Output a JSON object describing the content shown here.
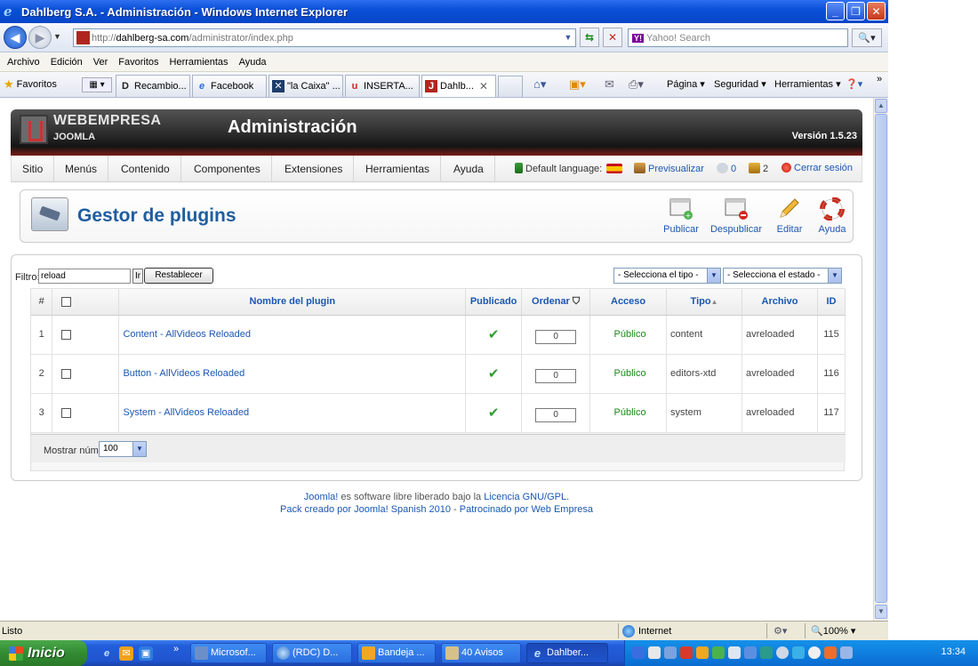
{
  "window": {
    "title": "Dahlberg S.A. - Administración - Windows Internet Explorer",
    "minimize": "_",
    "maximize": "❐",
    "close": "✕"
  },
  "address": {
    "url_prefix": "http://",
    "url_domain": "dahlberg-sa.com",
    "url_path": "/administrator/index.php",
    "search_placeholder": "Yahoo! Search",
    "search_logo": "Y!"
  },
  "menubar": [
    "Archivo",
    "Edición",
    "Ver",
    "Favoritos",
    "Herramientas",
    "Ayuda"
  ],
  "favorites_label": "Favoritos",
  "browser_tabs": [
    {
      "label": "Recambio...",
      "icon": "D"
    },
    {
      "label": "Facebook",
      "icon": "e"
    },
    {
      "label": "\"la Caixa\" ...",
      "icon": "✕"
    },
    {
      "label": "INSERTA...",
      "icon": "u"
    },
    {
      "label": "Dahlb...",
      "icon": "J",
      "active": true
    }
  ],
  "commands": {
    "page": "Página ▾",
    "security": "Seguridad ▾",
    "tools": "Herramientas ▾",
    "help": "❓▾",
    "more": "»"
  },
  "joomla": {
    "brand": "WEBEMPRESA",
    "brand_sub": "JOOMLA",
    "title": "Administración",
    "version": "Versión 1.5.23",
    "menu": [
      "Sitio",
      "Menús",
      "Contenido",
      "Componentes",
      "Extensiones",
      "Herramientas",
      "Ayuda"
    ],
    "status": {
      "language": "Default language:",
      "preview": "Previsualizar",
      "messages": "0",
      "users": "2",
      "logout": "Cerrar sesión"
    }
  },
  "toolbar": {
    "page_title": "Gestor de plugins",
    "publish": "Publicar",
    "unpublish": "Despublicar",
    "edit": "Editar",
    "help": "Ayuda"
  },
  "filter": {
    "label": "Filtro:",
    "value": "reload",
    "go": "Ir",
    "reset": "Restablecer",
    "type_select": "- Selecciona el tipo -",
    "state_select": "- Selecciona el estado -"
  },
  "table": {
    "headers": {
      "num": "#",
      "name": "Nombre del plugin",
      "published": "Publicado",
      "order": "Ordenar",
      "access": "Acceso",
      "type": "Tipo",
      "file": "Archivo",
      "id": "ID"
    },
    "rows": [
      {
        "num": "1",
        "name": "Content - AllVideos Reloaded",
        "order": "0",
        "access": "Público",
        "type": "content",
        "file": "avreloaded",
        "id": "115"
      },
      {
        "num": "2",
        "name": "Button - AllVideos Reloaded",
        "order": "0",
        "access": "Público",
        "type": "editors-xtd",
        "file": "avreloaded",
        "id": "116"
      },
      {
        "num": "3",
        "name": "System - AllVideos Reloaded",
        "order": "0",
        "access": "Público",
        "type": "system",
        "file": "avreloaded",
        "id": "117"
      }
    ],
    "show_label": "Mostrar núm.",
    "limit": "100"
  },
  "footer": {
    "line1_a": "Joomla!",
    "line1_b": " es software libre liberado bajo la ",
    "line1_c": "Licencia GNU/GPL.",
    "line2_a": "Pack creado por Joomla! Spanish 2010",
    "line2_b": " - ",
    "line2_c": "Patrocinado por Web Empresa"
  },
  "statusbar": {
    "text": "Listo",
    "zone": "Internet",
    "zoom": "100%"
  },
  "taskbar": {
    "start": "Inicio",
    "tasks": [
      "Microsof...",
      "(RDC) D...",
      "Bandeja ...",
      "40 Avisos",
      "Dahlber..."
    ],
    "clock": "13:34"
  }
}
